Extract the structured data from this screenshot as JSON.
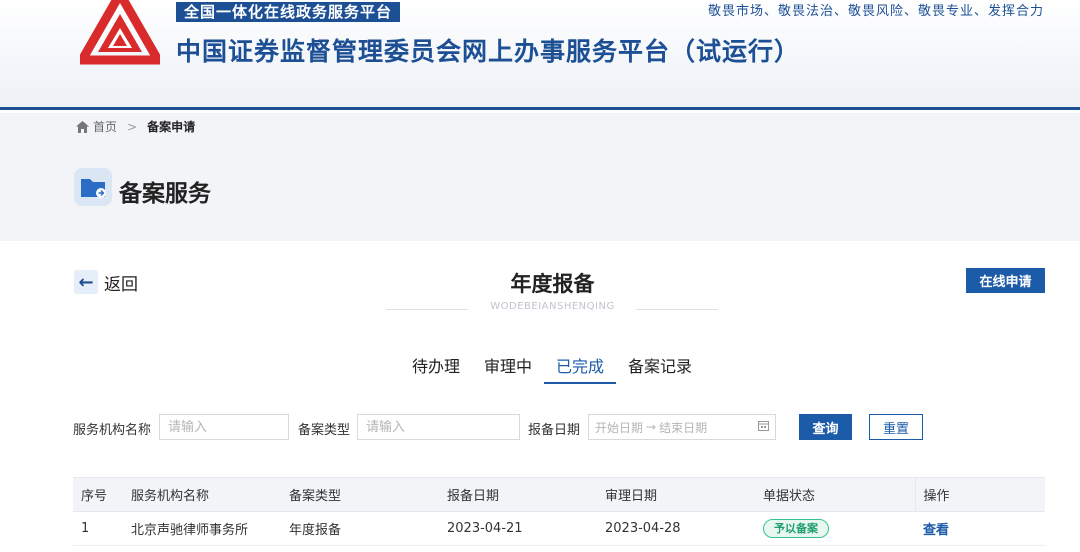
{
  "header": {
    "platform_tag": "全国一体化在线政务服务平台",
    "site_title": "中国证券监督管理委员会网上办事服务平台（试运行）",
    "slogan": "敬畏市场、敬畏法治、敬畏风险、敬畏专业、发挥合力",
    "brand_color": "#1c4f94",
    "logo_color": "#d92b2b"
  },
  "breadcrumb": {
    "home": "首页",
    "separator": ">",
    "current": "备案申请"
  },
  "service": {
    "title": "备案服务",
    "icon": "folder-share-icon"
  },
  "main": {
    "back_label": "返回",
    "heading": "年度报备",
    "heading_sub": "WODEBEIANSHENQING",
    "apply_label": "在线申请",
    "tabs": [
      {
        "label": "待办理",
        "active": false
      },
      {
        "label": "审理中",
        "active": false
      },
      {
        "label": "已完成",
        "active": true
      },
      {
        "label": "备案记录",
        "active": false
      }
    ]
  },
  "filter": {
    "org_label": "服务机构名称",
    "org_placeholder": "请输入",
    "type_label": "备案类型",
    "type_placeholder": "请输入",
    "date_label": "报备日期",
    "date_start_placeholder": "开始日期",
    "date_arrow": "→",
    "date_end_placeholder": "结束日期",
    "query_label": "查询",
    "reset_label": "重置"
  },
  "table": {
    "columns": [
      "序号",
      "服务机构名称",
      "备案类型",
      "报备日期",
      "审理日期",
      "单据状态",
      "操作"
    ],
    "rows": [
      {
        "index": "1",
        "org": "北京声驰律师事务所",
        "type": "年度报备",
        "report_date": "2023-04-21",
        "review_date": "2023-04-28",
        "status": "予以备案",
        "action": "查看"
      }
    ]
  }
}
